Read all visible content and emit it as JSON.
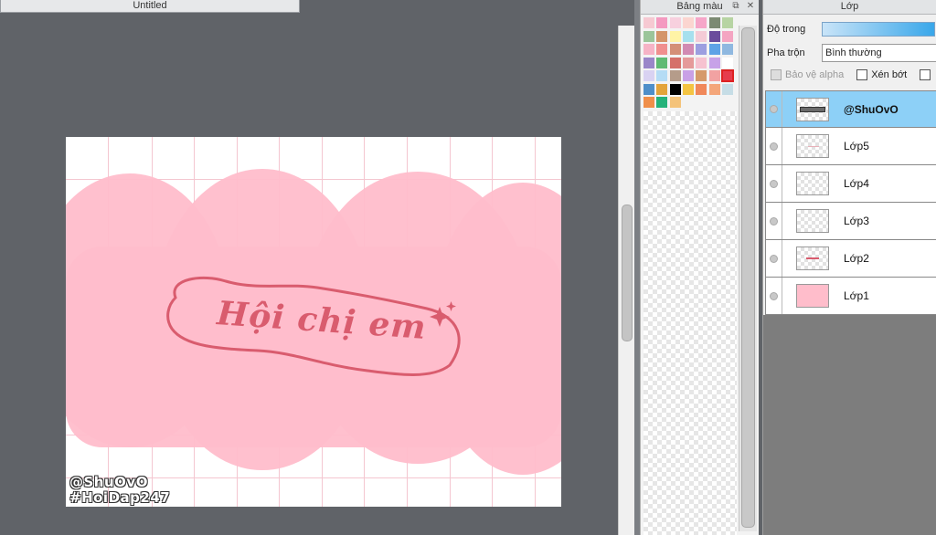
{
  "document": {
    "tab_title": "Untitled"
  },
  "artwork": {
    "title_text": "Hội chị em",
    "watermark_line1": "@ShuOvO",
    "watermark_line2": "#HoiDap247",
    "cloud_color": "#ffbdcb",
    "text_color": "#d95c6e"
  },
  "palette_panel": {
    "title": "Bảng màu",
    "swatch_colors": [
      "#f6c9d2",
      "#f49ac0",
      "#f7d0de",
      "#fbd5d0",
      "#f6a6c9",
      "#7c8a73",
      "#b7d4a3",
      "#9bc59a",
      "#d4956a",
      "#fff3a6",
      "#a6e0ee",
      "#f4cbd6",
      "#6a4c9c",
      "#f4a5c2",
      "#f6b3c6",
      "#f08f8e",
      "#d48f78",
      "#d18ab3",
      "#9c9fe0",
      "#5ea3e6",
      "#8fb8e0",
      "#9a86c9",
      "#5fba73",
      "#d5706a",
      "#e59a9a",
      "#f6c2d0",
      "#c7a2e8",
      "#ffffff",
      "#d9d2f2",
      "#b5dcf5",
      "#b59c8a",
      "#c9a0e6",
      "#d59a6a",
      "#f2a2a2",
      "#e63c4c",
      "#4f8fc9",
      "#e3a43a",
      "#000000",
      "#f4c442",
      "#f0885a",
      "#f4a67a",
      "#c6dde6",
      "#f08f4a",
      "#25b27a",
      "#f4c37a"
    ],
    "selected_swatch": 34
  },
  "layer_panel": {
    "title": "Lớp",
    "opacity_label": "Độ trong",
    "blend_label": "Pha trộn",
    "blend_value": "Bình thường",
    "protect_alpha_label": "Bảo vệ alpha",
    "clip_label": "Xén bớt",
    "layers": [
      {
        "name": "@ShuOvO",
        "active": true
      },
      {
        "name": "Lớp5",
        "active": false
      },
      {
        "name": "Lớp4",
        "active": false
      },
      {
        "name": "Lớp3",
        "active": false
      },
      {
        "name": "Lớp2",
        "active": false
      },
      {
        "name": "Lớp1",
        "active": false
      }
    ]
  }
}
